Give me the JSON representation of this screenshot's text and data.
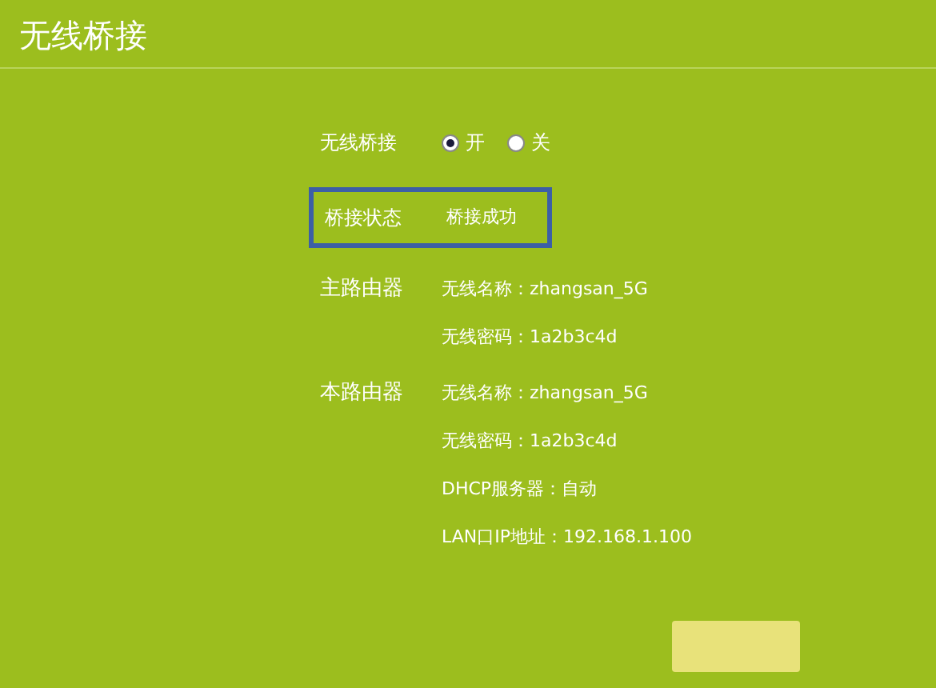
{
  "title": "无线桥接",
  "bridge": {
    "label": "无线桥接",
    "options": [
      {
        "label": "开",
        "selected": true
      },
      {
        "label": "关",
        "selected": false
      }
    ]
  },
  "status": {
    "label": "桥接状态",
    "value": "桥接成功",
    "highlighted": true
  },
  "sections": [
    {
      "label": "主路由器",
      "lines": [
        "无线名称：zhangsan_5G",
        "无线密码：1a2b3c4d"
      ]
    },
    {
      "label": "本路由器",
      "lines": [
        "无线名称：zhangsan_5G",
        "无线密码：1a2b3c4d",
        "DHCP服务器：自动",
        "LAN口IP地址：192.168.1.100"
      ]
    }
  ]
}
